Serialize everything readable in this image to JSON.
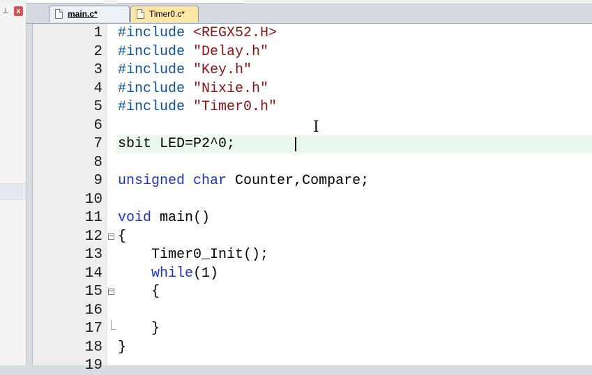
{
  "left_panel": {
    "pin_glyph": "⊥",
    "close_glyph": "x"
  },
  "tabs": [
    {
      "label": "main.c*",
      "active": true
    },
    {
      "label": "Timer0.c*",
      "active": false
    }
  ],
  "editor": {
    "current_line": 7,
    "lines": [
      {
        "number": "1",
        "code": "#include <REGX52.H>"
      },
      {
        "number": "2",
        "code": "#include \"Delay.h\""
      },
      {
        "number": "3",
        "code": "#include \"Key.h\""
      },
      {
        "number": "4",
        "code": "#include \"Nixie.h\""
      },
      {
        "number": "5",
        "code": "#include \"Timer0.h\""
      },
      {
        "number": "6",
        "code": ""
      },
      {
        "number": "7",
        "code": "sbit LED=P2^0;"
      },
      {
        "number": "8",
        "code": ""
      },
      {
        "number": "9",
        "code": "unsigned char Counter,Compare;"
      },
      {
        "number": "10",
        "code": ""
      },
      {
        "number": "11",
        "code": "void main()"
      },
      {
        "number": "12",
        "code": "{"
      },
      {
        "number": "13",
        "code": "    Timer0_Init();"
      },
      {
        "number": "14",
        "code": "    while(1)"
      },
      {
        "number": "15",
        "code": "    {"
      },
      {
        "number": "16",
        "code": ""
      },
      {
        "number": "17",
        "code": "    }"
      },
      {
        "number": "18",
        "code": "}"
      },
      {
        "number": "19",
        "code": ""
      }
    ]
  },
  "colors": {
    "keyword": "#1a35c8",
    "string": "#8a1313",
    "preprocessor": "#0c54a0",
    "current_line_bg": "#e9f8ea",
    "active_tab": "#eef1f5",
    "modified_tab": "#fbe6a6"
  }
}
